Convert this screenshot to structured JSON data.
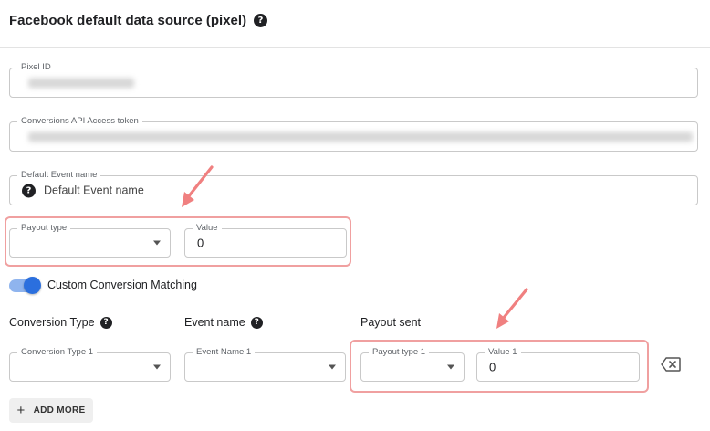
{
  "header": {
    "title": "Facebook default data source (pixel)",
    "help_icon": "help-circle-icon"
  },
  "pixel_id": {
    "label": "Pixel ID",
    "value": ""
  },
  "capi_token": {
    "label": "Conversions API Access token",
    "value": ""
  },
  "default_event": {
    "label": "Default Event name",
    "value": "Default Event name",
    "icon": "help-circle-icon"
  },
  "payout_type": {
    "label": "Payout type",
    "value": ""
  },
  "payout_value": {
    "label": "Value",
    "value": "0"
  },
  "custom_matching": {
    "label": "Custom Conversion Matching",
    "enabled": true
  },
  "columns": {
    "conversion_type": "Conversion Type",
    "event_name": "Event name",
    "payout_sent": "Payout sent"
  },
  "row1": {
    "conversion_type_label": "Conversion Type 1",
    "event_name_label": "Event Name 1",
    "payout_type_label": "Payout type 1",
    "value_label": "Value 1",
    "value": "0"
  },
  "actions": {
    "add_more": "ADD MORE",
    "remove_row_icon": "backspace-icon",
    "add_icon": "plus-icon"
  },
  "colors": {
    "accent": "#2b6fde",
    "toggle_track": "#8fb4ee",
    "annotation": "#f08080",
    "border": "#c9c9c9"
  }
}
